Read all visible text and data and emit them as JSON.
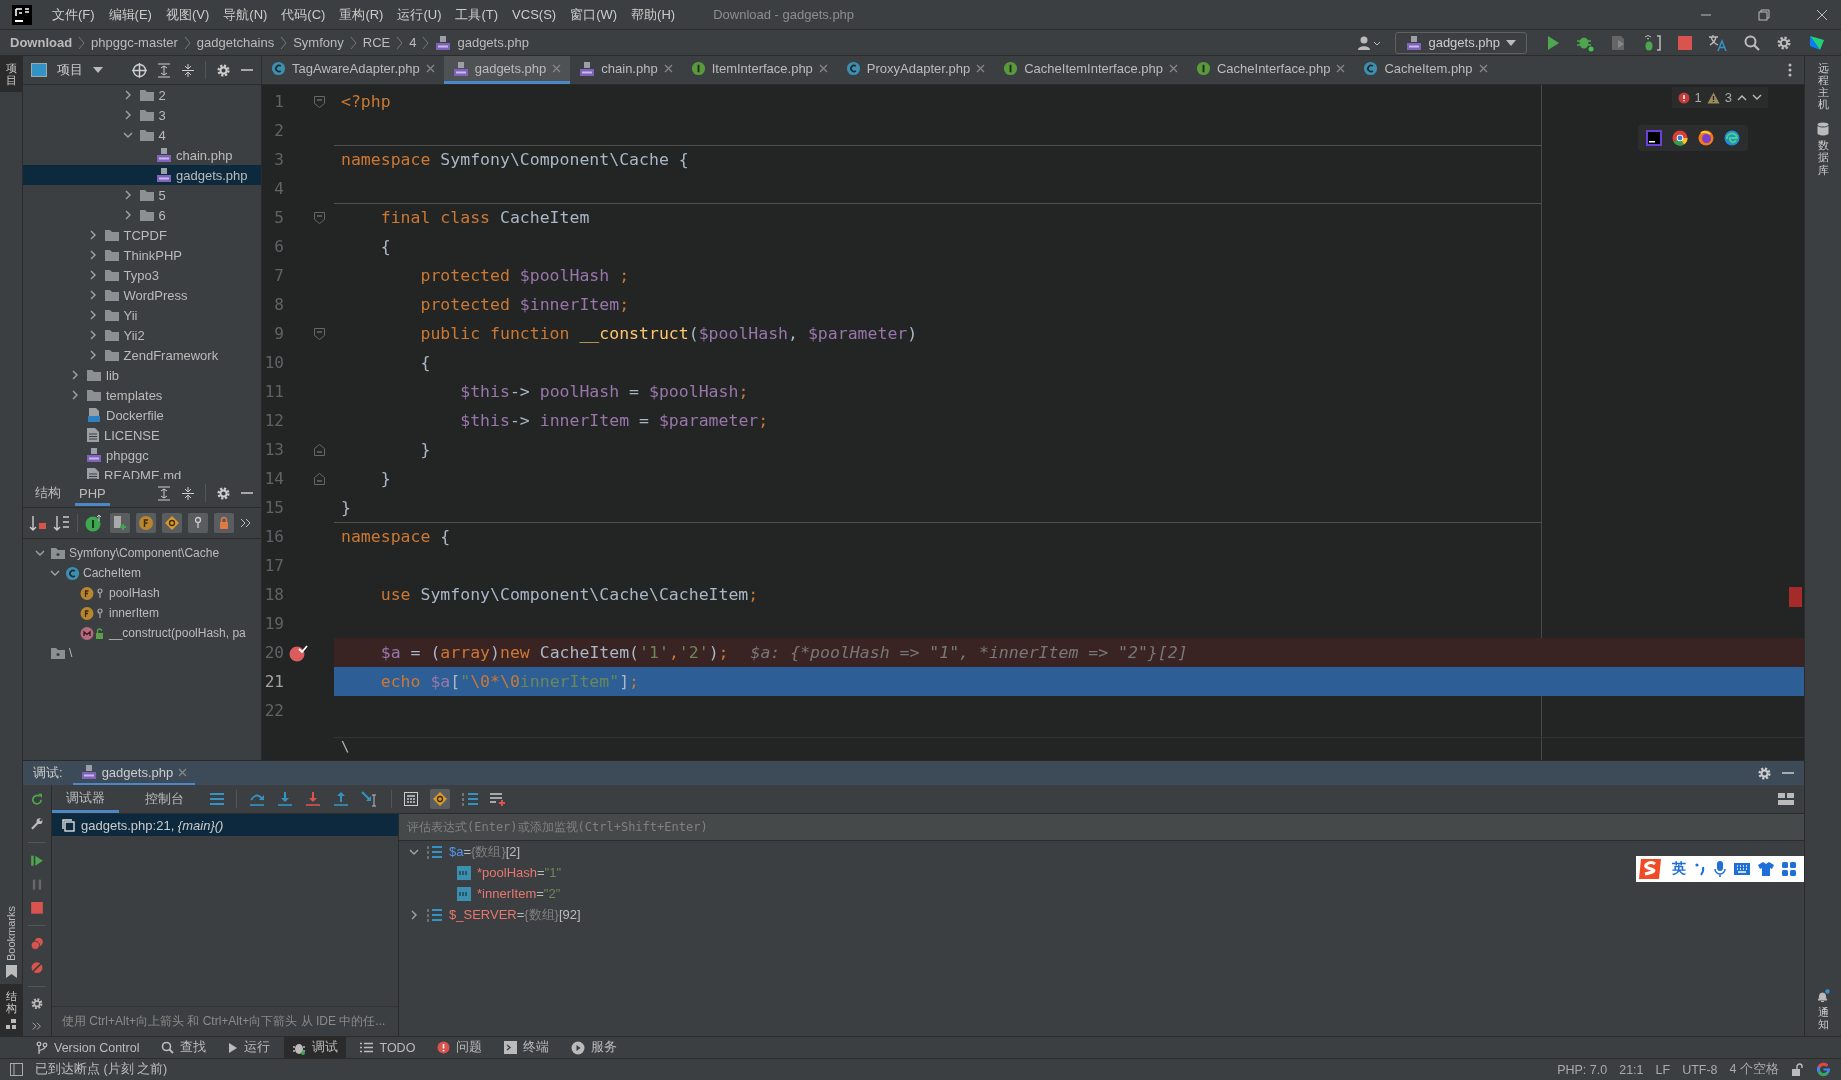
{
  "window": {
    "title": "Download - gadgets.php"
  },
  "menu": [
    "文件(F)",
    "编辑(E)",
    "视图(V)",
    "导航(N)",
    "代码(C)",
    "重构(R)",
    "运行(U)",
    "工具(T)",
    "VCS(S)",
    "窗口(W)",
    "帮助(H)"
  ],
  "breadcrumb": [
    {
      "label": "Download",
      "kind": "project"
    },
    {
      "label": "phpggc-master",
      "kind": "folder"
    },
    {
      "label": "gadgetchains",
      "kind": "folder"
    },
    {
      "label": "Symfony",
      "kind": "folder"
    },
    {
      "label": "RCE",
      "kind": "folder"
    },
    {
      "label": "4",
      "kind": "folder"
    },
    {
      "label": "gadgets.php",
      "kind": "php"
    }
  ],
  "run_config": {
    "label": "gadgets.php"
  },
  "left_stripe": {
    "top": [
      {
        "label": "项目",
        "selected": true
      }
    ],
    "bottom": [
      {
        "label": "Bookmarks",
        "kind": "bookmarks",
        "selected": false
      },
      {
        "label": "结构",
        "kind": "structure",
        "selected": true
      }
    ]
  },
  "right_stripe": [
    {
      "label": "远程主机",
      "kind": "remote"
    },
    {
      "label": "数据库",
      "kind": "database"
    },
    {
      "label": "通知",
      "kind": "notifications"
    }
  ],
  "project_panel": {
    "title": "项目",
    "tree": [
      {
        "children": [
          {
            "children": [
              {
                "children": [
                  {
                    "label": "2",
                    "kind": "folder",
                    "expanded": false,
                    "selected": false
                  },
                  {
                    "label": "3",
                    "kind": "folder",
                    "expanded": false,
                    "selected": false
                  },
                  {
                    "label": "4",
                    "kind": "folder",
                    "expanded": true,
                    "selected": false,
                    "children": [
                      {
                        "label": "chain.php",
                        "kind": "php",
                        "selected": false
                      },
                      {
                        "label": "gadgets.php",
                        "kind": "php",
                        "selected": true
                      }
                    ]
                  },
                  {
                    "label": "5",
                    "kind": "folder",
                    "expanded": false,
                    "selected": false
                  },
                  {
                    "label": "6",
                    "kind": "folder",
                    "expanded": false,
                    "selected": false
                  }
                ]
              }
            ]
          },
          {
            "label": "TCPDF",
            "kind": "folder",
            "expanded": false,
            "selected": false
          },
          {
            "label": "ThinkPHP",
            "kind": "folder",
            "expanded": false,
            "selected": false
          },
          {
            "label": "Typo3",
            "kind": "folder",
            "expanded": false,
            "selected": false
          },
          {
            "label": "WordPress",
            "kind": "folder",
            "expanded": false,
            "selected": false
          },
          {
            "label": "Yii",
            "kind": "folder",
            "expanded": false,
            "selected": false
          },
          {
            "label": "Yii2",
            "kind": "folder",
            "expanded": false,
            "selected": false
          },
          {
            "label": "ZendFramework",
            "kind": "folder",
            "expanded": false,
            "selected": false
          }
        ]
      },
      {
        "label": "lib",
        "kind": "folder",
        "expanded": false,
        "selected": false
      },
      {
        "label": "templates",
        "kind": "folder",
        "expanded": false,
        "selected": false
      },
      {
        "label": "Dockerfile",
        "kind": "docker",
        "selected": false
      },
      {
        "label": "LICENSE",
        "kind": "text",
        "selected": false
      },
      {
        "label": "phpggc",
        "kind": "php",
        "selected": false
      },
      {
        "label": "README.md",
        "kind": "text",
        "selected": false
      }
    ]
  },
  "structure_panel": {
    "tabs": [
      {
        "label": "结构",
        "selected": false
      },
      {
        "label": "PHP",
        "selected": true
      }
    ],
    "tree": [
      {
        "label": "Symfony\\Component\\Cache",
        "kind": "namespace",
        "expanded": true,
        "children": [
          {
            "label": "CacheItem",
            "kind": "class",
            "expanded": true,
            "children": [
              {
                "label": "poolHash",
                "kind": "field"
              },
              {
                "label": "innerItem",
                "kind": "field"
              },
              {
                "label": "__construct(poolHash, pa",
                "kind": "method"
              }
            ]
          }
        ]
      },
      {
        "label": "\\",
        "kind": "namespace"
      }
    ]
  },
  "editor": {
    "tabs": [
      {
        "label": "TagAwareAdapter.php",
        "kind": "class",
        "selected": false
      },
      {
        "label": "gadgets.php",
        "kind": "php",
        "selected": true
      },
      {
        "label": "chain.php",
        "kind": "php",
        "selected": false
      },
      {
        "label": "ItemInterface.php",
        "kind": "interface",
        "selected": false
      },
      {
        "label": "ProxyAdapter.php",
        "kind": "class",
        "selected": false
      },
      {
        "label": "CacheItemInterface.php",
        "kind": "interface",
        "selected": false
      },
      {
        "label": "CacheInterface.php",
        "kind": "interface",
        "selected": false
      },
      {
        "label": "CacheItem.php",
        "kind": "class",
        "selected": false
      }
    ],
    "inspections": {
      "errors": "1",
      "warnings": "3"
    },
    "lines": [
      {
        "number": "1",
        "fold_start": true,
        "tokens": [
          {
            "kind": "kw",
            "text": "<?php"
          }
        ]
      },
      {
        "number": "2"
      },
      {
        "number": "3",
        "separator": true,
        "tokens": [
          {
            "kind": "kw",
            "text": "namespace "
          },
          {
            "kind": "txt",
            "text": "Symfony\\Component\\Cache {"
          }
        ]
      },
      {
        "number": "4"
      },
      {
        "number": "5",
        "separator": true,
        "fold_start": true,
        "tokens": [
          {
            "kind": "kw",
            "text": "    final class "
          },
          {
            "kind": "txt",
            "text": "CacheItem"
          }
        ]
      },
      {
        "number": "6",
        "tokens": [
          {
            "kind": "txt",
            "text": "    {"
          }
        ]
      },
      {
        "number": "7",
        "tokens": [
          {
            "kind": "kw",
            "text": "        protected "
          },
          {
            "kind": "var",
            "text": "$poolHash"
          },
          {
            "kind": "kw",
            "text": " ;"
          }
        ]
      },
      {
        "number": "8",
        "tokens": [
          {
            "kind": "kw",
            "text": "        protected "
          },
          {
            "kind": "var",
            "text": "$innerItem"
          },
          {
            "kind": "kw",
            "text": ";"
          }
        ]
      },
      {
        "number": "9",
        "fold_start": true,
        "tokens": [
          {
            "kind": "kw",
            "text": "        public function "
          },
          {
            "kind": "fn",
            "text": "__construct"
          },
          {
            "kind": "txt",
            "text": "("
          },
          {
            "kind": "var",
            "text": "$poolHash"
          },
          {
            "kind": "txt",
            "text": ", "
          },
          {
            "kind": "var",
            "text": "$parameter"
          },
          {
            "kind": "txt",
            "text": ")"
          }
        ]
      },
      {
        "number": "10",
        "tokens": [
          {
            "kind": "txt",
            "text": "        {"
          }
        ]
      },
      {
        "number": "11",
        "tokens": [
          {
            "kind": "var",
            "text": "            $this"
          },
          {
            "kind": "txt",
            "text": "-> "
          },
          {
            "kind": "var",
            "text": "poolHash"
          },
          {
            "kind": "txt",
            "text": " = "
          },
          {
            "kind": "var",
            "text": "$poolHash"
          },
          {
            "kind": "kw",
            "text": ";"
          }
        ]
      },
      {
        "number": "12",
        "tokens": [
          {
            "kind": "var",
            "text": "            $this"
          },
          {
            "kind": "txt",
            "text": "-> "
          },
          {
            "kind": "var",
            "text": "innerItem"
          },
          {
            "kind": "txt",
            "text": " = "
          },
          {
            "kind": "var",
            "text": "$parameter"
          },
          {
            "kind": "kw",
            "text": ";"
          }
        ]
      },
      {
        "number": "13",
        "fold_end": true,
        "tokens": [
          {
            "kind": "txt",
            "text": "        }"
          }
        ]
      },
      {
        "number": "14",
        "fold_end": true,
        "tokens": [
          {
            "kind": "txt",
            "text": "    }"
          }
        ]
      },
      {
        "number": "15",
        "tokens": [
          {
            "kind": "txt",
            "text": "}"
          }
        ]
      },
      {
        "number": "16",
        "separator": true,
        "tokens": [
          {
            "kind": "kw",
            "text": "namespace "
          },
          {
            "kind": "txt",
            "text": "{"
          }
        ]
      },
      {
        "number": "17"
      },
      {
        "number": "18",
        "tokens": [
          {
            "kind": "kw",
            "text": "    use "
          },
          {
            "kind": "txt",
            "text": "Symfony\\Component\\Cache\\CacheItem"
          },
          {
            "kind": "kw",
            "text": ";"
          }
        ]
      },
      {
        "number": "19"
      },
      {
        "number": "20",
        "breakpoint": true,
        "hint": "$a: {*poolHash => \"1\", *innerItem => \"2\"}[2]",
        "tokens": [
          {
            "kind": "var",
            "text": "    $a"
          },
          {
            "kind": "txt",
            "text": " = ("
          },
          {
            "kind": "kw",
            "text": "array"
          },
          {
            "kind": "txt",
            "text": ")"
          },
          {
            "kind": "kw",
            "text": "new "
          },
          {
            "kind": "txt",
            "text": "CacheItem("
          },
          {
            "kind": "str",
            "text": "'1'"
          },
          {
            "kind": "kw",
            "text": ","
          },
          {
            "kind": "str",
            "text": "'2'"
          },
          {
            "kind": "txt",
            "text": ")"
          },
          {
            "kind": "kw",
            "text": ";"
          }
        ]
      },
      {
        "number": "21",
        "current": true,
        "tokens": [
          {
            "kind": "kw",
            "text": "    echo "
          },
          {
            "kind": "var",
            "text": "$a"
          },
          {
            "kind": "txt",
            "text": "["
          },
          {
            "kind": "str",
            "text": "\""
          },
          {
            "kind": "kw",
            "text": "\\0*\\0"
          },
          {
            "kind": "str",
            "text": "innerItem\""
          },
          {
            "kind": "txt",
            "text": "]"
          },
          {
            "kind": "kw",
            "text": ";"
          }
        ]
      },
      {
        "number": "22"
      }
    ],
    "breadcrumb": "\\"
  },
  "debug": {
    "title": "调试:",
    "session_tab": {
      "label": "gadgets.php"
    },
    "tabs": [
      {
        "label": "调试器",
        "selected": true
      },
      {
        "label": "控制台",
        "selected": false
      }
    ],
    "frames": [
      {
        "label": "gadgets.php:21, *{main}()*",
        "selected": true
      }
    ],
    "hint": "使用 Ctrl+Alt+向上箭头 和 Ctrl+Alt+向下箭头 从 IDE 中的任...",
    "watch": {
      "placeholder": "评估表达式(Enter)或添加监视(Ctrl+Shift+Enter)"
    },
    "variables": [
      {
        "name": "$a",
        "color": "#5394ec",
        "operator": "=",
        "type": "{数组}",
        "value": "[2]",
        "kind": "array",
        "expanded": true,
        "children": [
          {
            "name": "*poolHash",
            "color": "#e8776f",
            "operator": "=",
            "value": "\"1\"",
            "kind": "string"
          },
          {
            "name": "*innerItem",
            "color": "#e8776f",
            "operator": "=",
            "value": "\"2\"",
            "kind": "string"
          }
        ]
      },
      {
        "name": "$_SERVER",
        "color": "#e8776f",
        "operator": "=",
        "type": "{数组}",
        "value": "[92]",
        "kind": "array",
        "expanded": false
      }
    ]
  },
  "ime_toolbar": {
    "mode": "英"
  },
  "tool_windows": [
    {
      "label": "Version Control",
      "kind": "vcs",
      "selected": false
    },
    {
      "label": "查找",
      "kind": "find",
      "selected": false
    },
    {
      "label": "运行",
      "kind": "run",
      "selected": false
    },
    {
      "label": "调试",
      "kind": "debug",
      "selected": true
    },
    {
      "label": "TODO",
      "kind": "todo",
      "selected": false
    },
    {
      "label": "问题",
      "kind": "problems",
      "selected": false
    },
    {
      "label": "终端",
      "kind": "terminal",
      "selected": false
    },
    {
      "label": "服务",
      "kind": "services",
      "selected": false
    }
  ],
  "status": {
    "message": "已到达断点 (片刻 之前)",
    "items": [
      "PHP: 7.0",
      "21:1",
      "LF",
      "UTF-8",
      "4 个空格"
    ]
  }
}
